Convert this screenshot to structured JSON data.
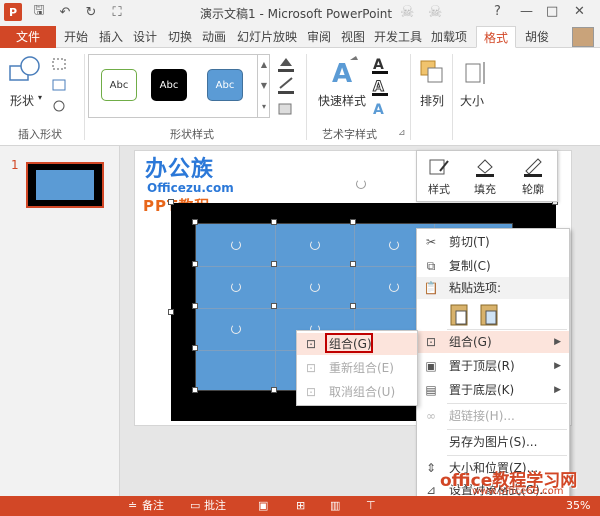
{
  "titlebar": {
    "title": "演示文稿1 - Microsoft PowerPoint",
    "logo": "P",
    "window_controls": [
      "?",
      "—",
      "□",
      "✕"
    ]
  },
  "tabs": {
    "file": "文件",
    "items": [
      "开始",
      "插入",
      "设计",
      "切换",
      "动画",
      "幻灯片放映",
      "审阅",
      "视图",
      "开发工具",
      "加载项"
    ],
    "active": "格式",
    "user": "胡俊"
  },
  "ribbon": {
    "insert_shapes": {
      "label": "插入形状",
      "shape_btn": "形状"
    },
    "shape_styles": {
      "label": "形状样式",
      "sample": "Abc"
    },
    "art_styles": {
      "label": "艺术字样式",
      "quick_styles": "快速样式"
    },
    "arrange": "排列",
    "size": "大小"
  },
  "slides_pane": {
    "slide_number": "1"
  },
  "slide": {
    "logo_text": "办公族",
    "logo_domain": "Officezu.com",
    "logo_sub": "PPT教程"
  },
  "mini_toolbar": {
    "style": "样式",
    "fill": "填充",
    "outline": "轮廓"
  },
  "context_menu": {
    "items": [
      {
        "label": "剪切(T)",
        "icon": "scissors-icon"
      },
      {
        "label": "复制(C)",
        "icon": "copy-icon"
      },
      {
        "label": "粘贴选项:",
        "icon": "paste-icon"
      },
      {
        "label": "组合(G)",
        "icon": "group-icon"
      },
      {
        "label": "置于顶层(R)",
        "icon": "bring-front-icon"
      },
      {
        "label": "置于底层(K)",
        "icon": "send-back-icon"
      },
      {
        "label": "超链接(H)...",
        "icon": "link-icon"
      },
      {
        "label": "另存为图片(S)...",
        "icon": ""
      },
      {
        "label": "大小和位置(Z)...",
        "icon": "size-icon"
      },
      {
        "label": "设置对象格式(O)...",
        "icon": "format-icon"
      }
    ]
  },
  "submenu": {
    "items": [
      {
        "label": "组合(G)"
      },
      {
        "label": "重新组合(E)"
      },
      {
        "label": "取消组合(U)"
      }
    ]
  },
  "status_bar": {
    "notes": "备注",
    "comments": "批注",
    "zoom": "35%"
  },
  "watermark": {
    "line1": "office教程学习网",
    "line2": "www.office68.com"
  },
  "colors": {
    "accent": "#d24726",
    "shape_fill": "#5b9bd5",
    "menu_highlight": "#fce4dc",
    "red_box": "#c00000"
  }
}
